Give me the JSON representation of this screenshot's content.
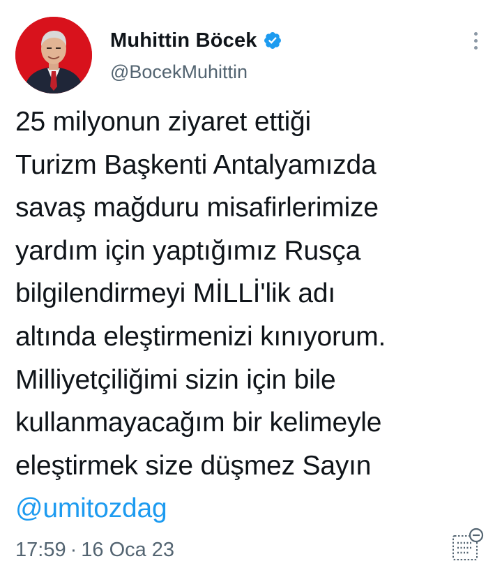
{
  "author": {
    "display_name": "Muhittin Böcek",
    "handle": "@BocekMuhittin",
    "verified": true
  },
  "tweet": {
    "lines": [
      "25 milyonun ziyaret ettiği",
      "Turizm Başkenti Antalyamızda",
      "savaş mağduru misafirlerimize",
      "yardım için yaptığımız Rusça",
      "bilgilendirmeyi MİLLİ'lik adı",
      "altında eleştirmenizi kınıyorum.",
      "Milliyetçiliğimi sizin için bile",
      "kullanmayacağım bir kelimeyle",
      "eleştirmek size düşmez Sayın"
    ],
    "mention": "@umitozdag"
  },
  "meta": {
    "time": "17:59",
    "separator": "·",
    "date": "16 Oca 23"
  },
  "icons": {
    "verified": "verified-badge-icon",
    "more": "more-options-icon",
    "analytics": "tweet-analytics-icon"
  },
  "colors": {
    "accent": "#1d9bf0",
    "text": "#0f1419",
    "secondary": "#536471",
    "avatar_bg": "#d8121c"
  }
}
